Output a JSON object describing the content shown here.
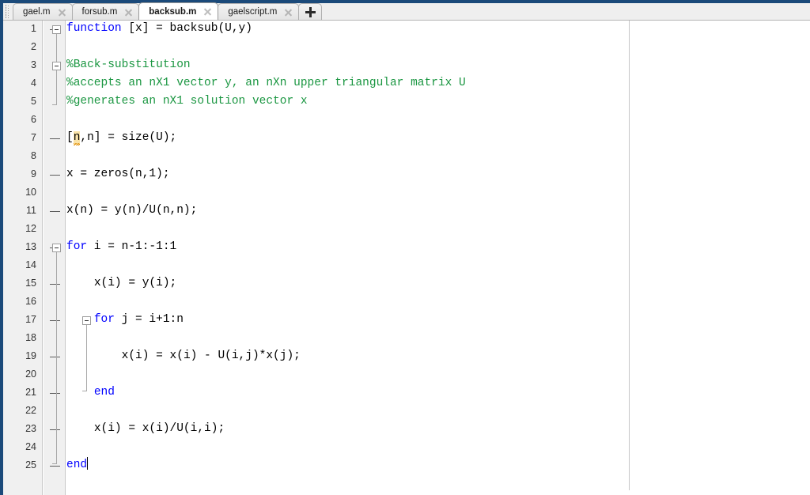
{
  "window": {
    "accent_color": "#1b4a7a",
    "background": "#ffffff"
  },
  "tabbar": {
    "grip_name": "tab-drag-grip",
    "new_tab_label": "+",
    "tabs": [
      {
        "label": "gael.m",
        "active": false,
        "close_label": "×"
      },
      {
        "label": "forsub.m",
        "active": false,
        "close_label": "×"
      },
      {
        "label": "backsub.m",
        "active": true,
        "close_label": "×"
      },
      {
        "label": "gaelscript.m",
        "active": false,
        "close_label": "×"
      }
    ]
  },
  "editor": {
    "filename": "backsub.m",
    "language": "MATLAB",
    "colors": {
      "keyword": "#0000ff",
      "comment": "#1a9641",
      "text": "#000000",
      "gutter_bg": "#f0f0f0",
      "warning_highlight": "#fae3a8"
    },
    "breakpoint_marker": "—",
    "lines": [
      {
        "n": 1,
        "bp": true,
        "text": "function [x] = backsub(U,y)"
      },
      {
        "n": 2,
        "bp": false,
        "text": ""
      },
      {
        "n": 3,
        "bp": false,
        "text": "%Back-substitution"
      },
      {
        "n": 4,
        "bp": false,
        "text": "%accepts an nX1 vector y, an nXn upper triangular matrix U"
      },
      {
        "n": 5,
        "bp": false,
        "text": "%generates an nX1 solution vector x"
      },
      {
        "n": 6,
        "bp": false,
        "text": ""
      },
      {
        "n": 7,
        "bp": true,
        "text": "[n,n] = size(U);"
      },
      {
        "n": 8,
        "bp": false,
        "text": ""
      },
      {
        "n": 9,
        "bp": true,
        "text": "x = zeros(n,1);"
      },
      {
        "n": 10,
        "bp": false,
        "text": ""
      },
      {
        "n": 11,
        "bp": true,
        "text": "x(n) = y(n)/U(n,n);"
      },
      {
        "n": 12,
        "bp": false,
        "text": ""
      },
      {
        "n": 13,
        "bp": true,
        "text": "for i = n-1:-1:1"
      },
      {
        "n": 14,
        "bp": false,
        "text": ""
      },
      {
        "n": 15,
        "bp": true,
        "text": "    x(i) = y(i);"
      },
      {
        "n": 16,
        "bp": false,
        "text": ""
      },
      {
        "n": 17,
        "bp": true,
        "text": "    for j = i+1:n"
      },
      {
        "n": 18,
        "bp": false,
        "text": ""
      },
      {
        "n": 19,
        "bp": true,
        "text": "        x(i) = x(i) - U(i,j)*x(j);"
      },
      {
        "n": 20,
        "bp": false,
        "text": ""
      },
      {
        "n": 21,
        "bp": true,
        "text": "    end"
      },
      {
        "n": 22,
        "bp": false,
        "text": ""
      },
      {
        "n": 23,
        "bp": true,
        "text": "    x(i) = x(i)/U(i,i);"
      },
      {
        "n": 24,
        "bp": false,
        "text": ""
      },
      {
        "n": 25,
        "bp": true,
        "text": "end"
      }
    ],
    "warning_token": "n",
    "caret_line": 25,
    "column_guide": true
  }
}
